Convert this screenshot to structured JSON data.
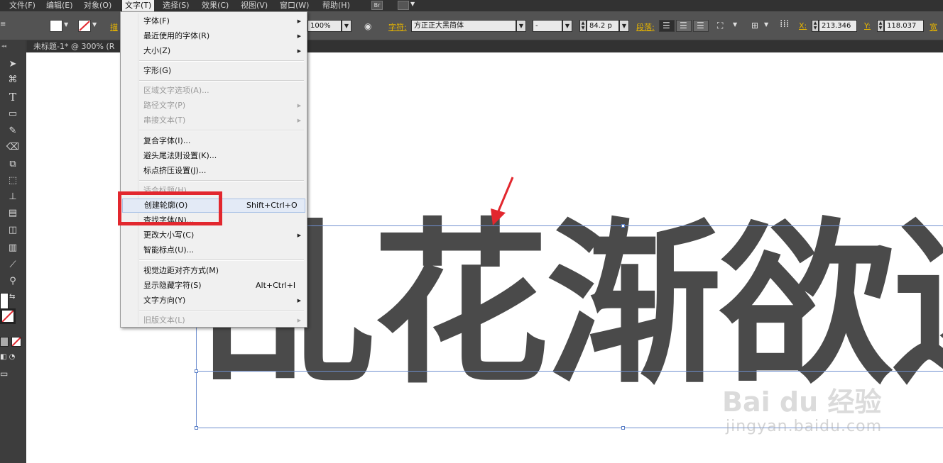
{
  "menubar": {
    "items": [
      "文件(F)",
      "编辑(E)",
      "对象(O)",
      "文字(T)",
      "选择(S)",
      "效果(C)",
      "视图(V)",
      "窗口(W)",
      "帮助(H)"
    ],
    "br_label": "Br"
  },
  "controlbar": {
    "stroke_label": "描",
    "opacity_value": "100%",
    "char_label": "字符:",
    "font_family": "方正正大黑简体",
    "font_style": "-",
    "font_size": "84.2 p",
    "para_label": "段落:",
    "x_label": "X:",
    "x_value": "213.346",
    "y_label": "Y:",
    "y_value": "118.037",
    "w_label": "宽"
  },
  "doc_tab": {
    "title": "未标题-1* @ 300% (R"
  },
  "canvas": {
    "text": "乱花渐欲迷",
    "watermark_logo": "Bai du 经验",
    "watermark_url": "jingyan.baidu.com"
  },
  "dropdown": {
    "items": [
      {
        "label": "字体(F)",
        "shortcut": "",
        "submenu": true,
        "disabled": false
      },
      {
        "label": "最近使用的字体(R)",
        "shortcut": "",
        "submenu": true,
        "disabled": false
      },
      {
        "label": "大小(Z)",
        "shortcut": "",
        "submenu": true,
        "disabled": false
      },
      {
        "label": "字形(G)",
        "shortcut": "",
        "submenu": false,
        "disabled": false
      },
      {
        "label": "区域文字选项(A)...",
        "shortcut": "",
        "submenu": false,
        "disabled": true
      },
      {
        "label": "路径文字(P)",
        "shortcut": "",
        "submenu": true,
        "disabled": true
      },
      {
        "label": "串接文本(T)",
        "shortcut": "",
        "submenu": true,
        "disabled": true
      },
      {
        "label": "复合字体(I)...",
        "shortcut": "",
        "submenu": false,
        "disabled": false
      },
      {
        "label": "避头尾法则设置(K)...",
        "shortcut": "",
        "submenu": false,
        "disabled": false
      },
      {
        "label": "标点挤压设置(J)...",
        "shortcut": "",
        "submenu": false,
        "disabled": false
      },
      {
        "label": "适合标题(H)",
        "shortcut": "",
        "submenu": false,
        "disabled": true
      },
      {
        "label": "创建轮廓(O)",
        "shortcut": "Shift+Ctrl+O",
        "submenu": false,
        "disabled": false
      },
      {
        "label": "查找字体(N)...",
        "shortcut": "",
        "submenu": false,
        "disabled": false
      },
      {
        "label": "更改大小写(C)",
        "shortcut": "",
        "submenu": true,
        "disabled": false
      },
      {
        "label": "智能标点(U)...",
        "shortcut": "",
        "submenu": false,
        "disabled": false
      },
      {
        "label": "视觉边距对齐方式(M)",
        "shortcut": "",
        "submenu": false,
        "disabled": false
      },
      {
        "label": "显示隐藏字符(S)",
        "shortcut": "Alt+Ctrl+I",
        "submenu": false,
        "disabled": false
      },
      {
        "label": "文字方向(Y)",
        "shortcut": "",
        "submenu": true,
        "disabled": false
      },
      {
        "label": "旧版文本(L)",
        "shortcut": "",
        "submenu": true,
        "disabled": true
      }
    ]
  },
  "tools": [
    "selection-tool",
    "lasso-tool",
    "type-tool",
    "rectangle-tool",
    "pencil-tool",
    "eraser-tool",
    "scale-tool",
    "free-transform-tool",
    "chart-tool",
    "gradient-tool",
    "live-paint-tool",
    "column-graph-tool",
    "eyedropper-tool",
    "zoom-tool"
  ],
  "colors": {
    "menubar_bg": "#323232",
    "panel_bg": "#535353",
    "annotation_red": "#e2272e",
    "text_gray": "#4a4a4a",
    "accent_label": "#e6b400"
  }
}
